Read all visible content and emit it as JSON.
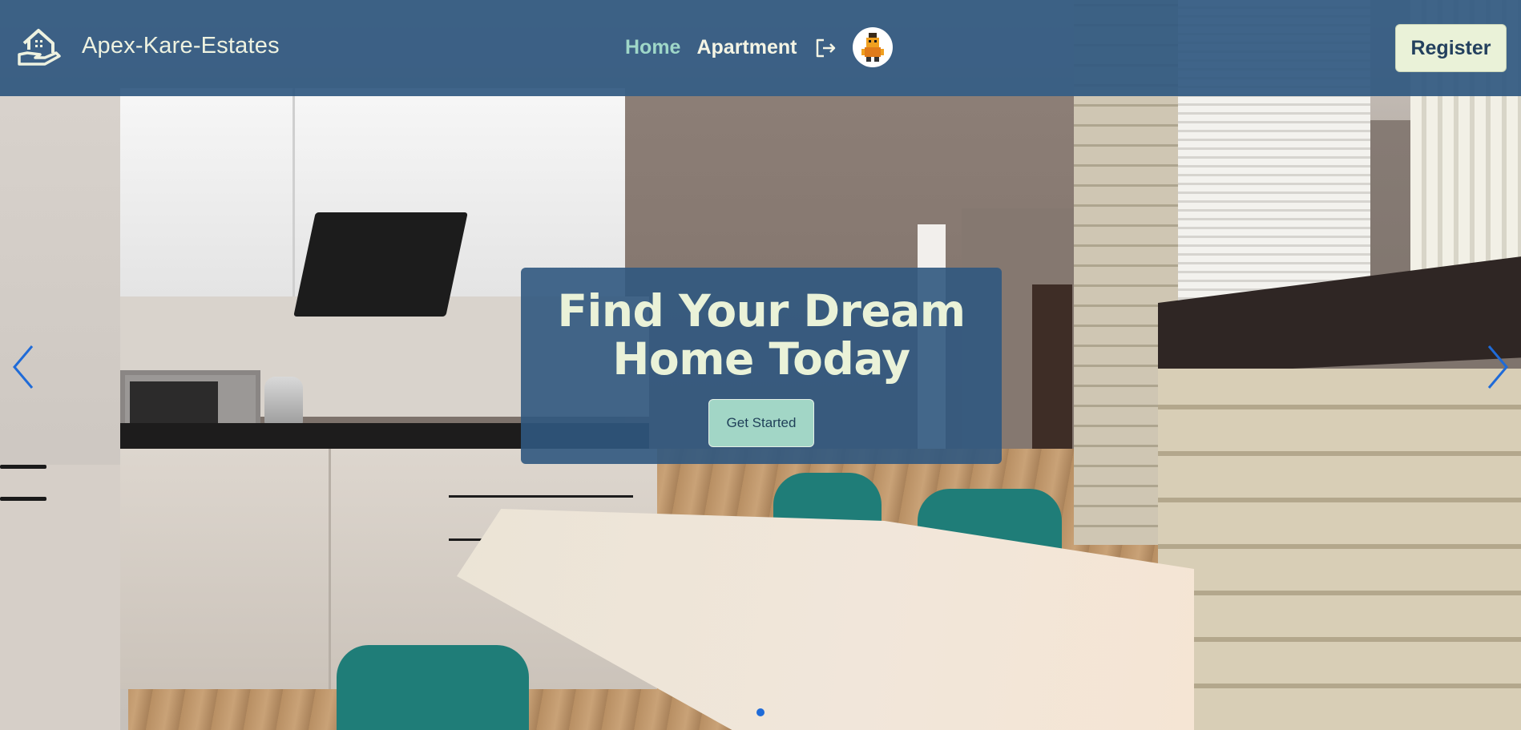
{
  "brand": {
    "name": "Apex-Kare-Estates",
    "logo_icon": "house-in-hand-icon"
  },
  "nav": {
    "home_label": "Home",
    "apartment_label": "Apartment",
    "logout_icon": "logout-icon",
    "avatar_icon": "user-avatar"
  },
  "header": {
    "register_label": "Register"
  },
  "hero": {
    "title_line1": "Find Your Dream",
    "title_line2": "Home Today",
    "cta_label": "Get Started"
  },
  "carousel": {
    "prev_icon": "chevron-left-icon",
    "next_icon": "chevron-right-icon",
    "slide_count": 1,
    "active_slide": 1
  },
  "colors": {
    "header_bg": "#305880",
    "nav_active": "#9fd7c8",
    "nav_text": "#f4f4e4",
    "register_bg": "#eaf2d8",
    "hero_text": "#eaf2d8",
    "cta_bg": "#a2d6c6",
    "carousel_accent": "#1f6bd8"
  }
}
